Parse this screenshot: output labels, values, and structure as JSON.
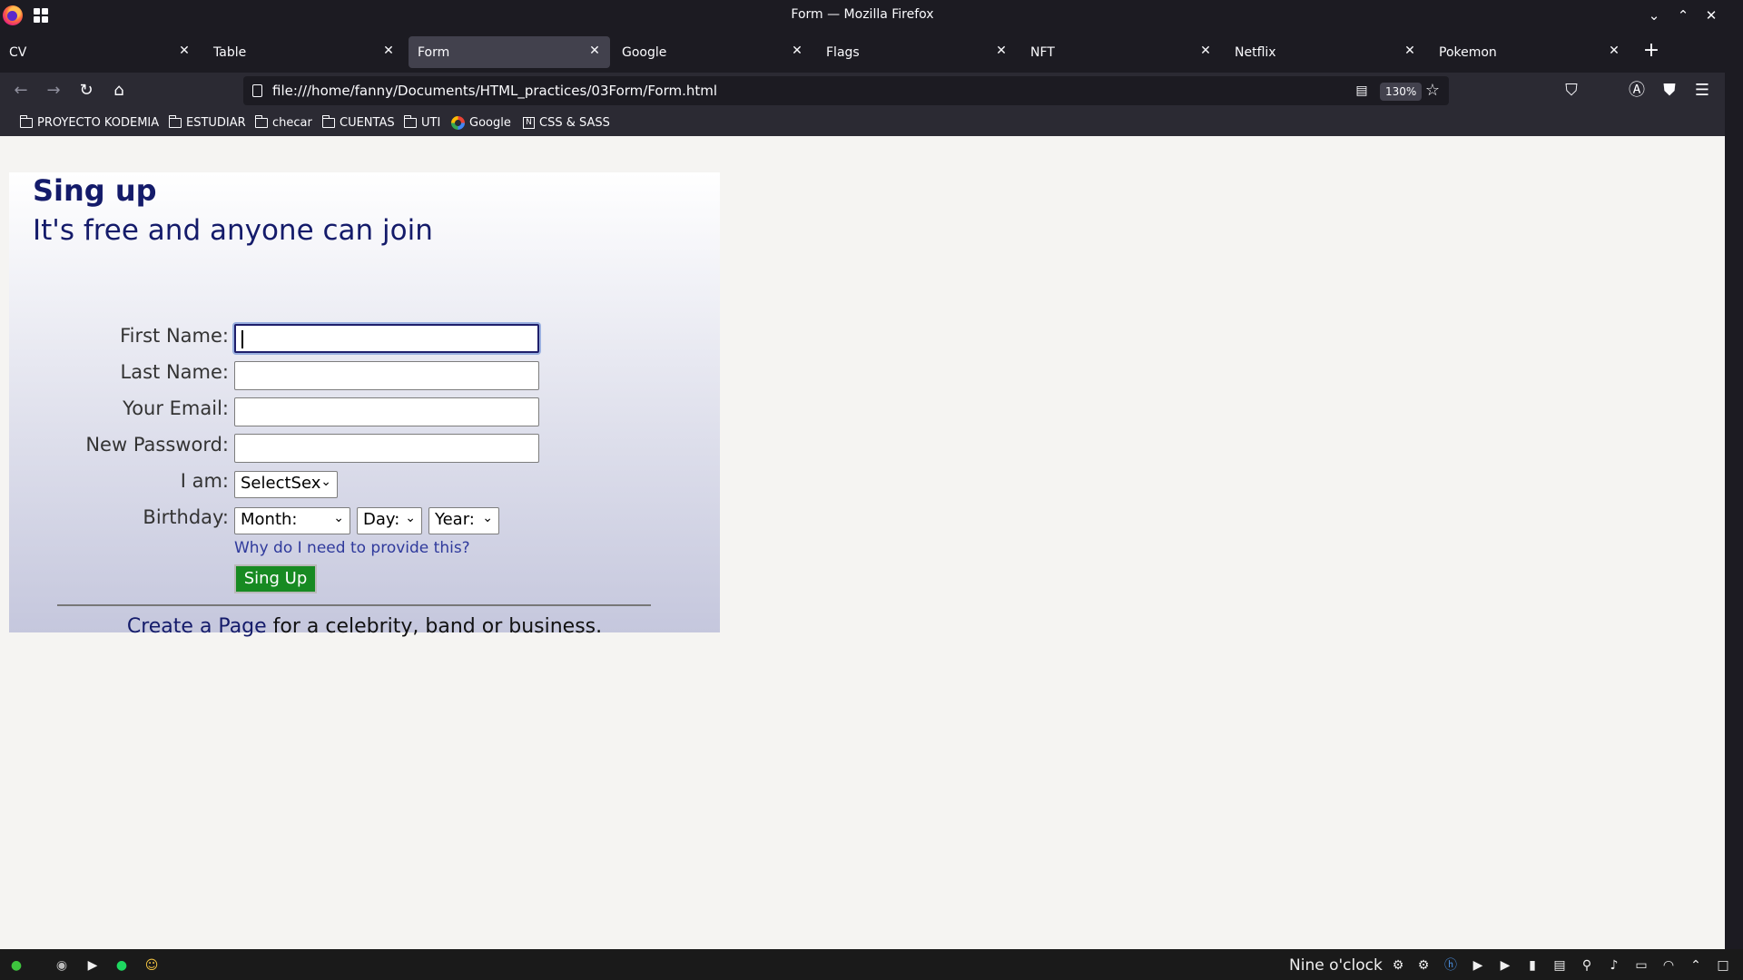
{
  "window": {
    "title": "Form — Mozilla Firefox",
    "minimize_glyph": "⌄",
    "maximize_glyph": "⌃",
    "close_glyph": "✕"
  },
  "tabs": [
    {
      "label": "CV",
      "active": false
    },
    {
      "label": "Table",
      "active": false
    },
    {
      "label": "Form",
      "active": true
    },
    {
      "label": "Google",
      "active": false
    },
    {
      "label": "Flags",
      "active": false
    },
    {
      "label": "NFT",
      "active": false
    },
    {
      "label": "Netflix",
      "active": false
    },
    {
      "label": "Pokemon",
      "active": false
    }
  ],
  "tab_close_glyph": "✕",
  "new_tab_glyph": "+",
  "navbar": {
    "back_glyph": "←",
    "forward_glyph": "→",
    "reload_glyph": "↻",
    "home_glyph": "⌂",
    "url": "file:///home/fanny/Documents/HTML_practices/03Form/Form.html",
    "zoom": "130%",
    "star_glyph": "☆",
    "reader_glyph": "▤",
    "pocket_glyph": "⛉",
    "account_glyph": "Ⓐ",
    "shield_glyph": "⛊",
    "menu_glyph": "☰"
  },
  "bookmarks": [
    {
      "label": "PROYECTO KODEMIA",
      "icon": "folder-icon"
    },
    {
      "label": "ESTUDIAR",
      "icon": "folder-icon"
    },
    {
      "label": "checar",
      "icon": "folder-icon"
    },
    {
      "label": "CUENTAS",
      "icon": "folder-icon"
    },
    {
      "label": "UTI",
      "icon": "folder-icon"
    },
    {
      "label": "Google",
      "icon": "google-icon"
    },
    {
      "label": "CSS & SASS",
      "icon": "notion-icon"
    }
  ],
  "form": {
    "title": "Sing up",
    "subtitle": "It's free and anyone can join",
    "first_name_label": "First Name:",
    "last_name_label": "Last Name:",
    "email_label": "Your Email:",
    "password_label": "New Password:",
    "sex_label": "I am:",
    "sex_select": "SelectSex",
    "birthday_label": "Birthday:",
    "month_select": "Month:",
    "day_select": "Day:",
    "year_select": "Year:",
    "why_link": "Why do I need to provide this?",
    "submit_label": "Sing Up",
    "create_page_link": "Create a Page",
    "create_page_rest": " for a celebrity, band or business."
  },
  "taskbar": {
    "clock": "Nine o'clock"
  },
  "colors": {
    "heading": "#141b6a",
    "button": "#178a22",
    "link": "#2f3a9c",
    "browser_dark": "#1c1b22"
  }
}
